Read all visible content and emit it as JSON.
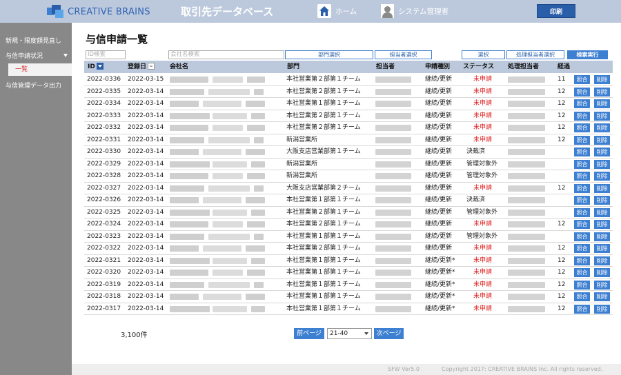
{
  "header": {
    "logo_text": "CREATIVE BRAINS",
    "app_title": "取引先データベース",
    "home_label": "ホーム",
    "user_label": "システム管理者",
    "print_label": "印刷"
  },
  "sidebar": {
    "item1": "新規・限度額見直し",
    "item2": "与信申請状況",
    "sub1": "一覧",
    "item3": "与信管理データ出力"
  },
  "page_title": "与信申請一覧",
  "filters": {
    "id_placeholder": "ID検索",
    "company_placeholder": "会社名検索",
    "dept_btn": "部門選択",
    "owner_btn": "担当者選択",
    "select_btn": "選択",
    "handler_btn": "処理担当者選択",
    "search_btn": "検索実行"
  },
  "columns": {
    "id": "ID",
    "date": "登録日",
    "company": "会社名",
    "dept": "部門",
    "owner": "担当者",
    "type": "申請種別",
    "status": "ステータス",
    "handler": "処理担当者",
    "elapsed": "経過"
  },
  "buttons": {
    "match": "照合",
    "delete": "削除"
  },
  "rows": [
    {
      "id": "2022-0336",
      "date": "2022-03-15",
      "dept": "本社営業第２部第１チーム",
      "type": "継続/更新",
      "status": "未申請",
      "status_red": true,
      "elapsed": "11"
    },
    {
      "id": "2022-0335",
      "date": "2022-03-14",
      "dept": "本社営業第２部第１チーム",
      "type": "継続/更新",
      "status": "未申請",
      "status_red": true,
      "elapsed": "12"
    },
    {
      "id": "2022-0334",
      "date": "2022-03-14",
      "dept": "本社営業第１部第１チーム",
      "type": "継続/更新",
      "status": "未申請",
      "status_red": true,
      "elapsed": "12"
    },
    {
      "id": "2022-0333",
      "date": "2022-03-14",
      "dept": "本社営業第２部第１チーム",
      "type": "継続/更新",
      "status": "未申請",
      "status_red": true,
      "elapsed": "12"
    },
    {
      "id": "2022-0332",
      "date": "2022-03-14",
      "dept": "本社営業第２部第１チーム",
      "type": "継続/更新",
      "status": "未申請",
      "status_red": true,
      "elapsed": "12"
    },
    {
      "id": "2022-0331",
      "date": "2022-03-14",
      "dept": "新潟営業所",
      "type": "継続/更新",
      "status": "未申請",
      "status_red": true,
      "elapsed": "12"
    },
    {
      "id": "2022-0330",
      "date": "2022-03-14",
      "dept": "大阪支店営業部第１チーム",
      "type": "継続/更新",
      "status": "決裁済",
      "status_red": false,
      "elapsed": ""
    },
    {
      "id": "2022-0329",
      "date": "2022-03-14",
      "dept": "新潟営業所",
      "type": "継続/更新",
      "status": "管理対象外",
      "status_red": false,
      "elapsed": ""
    },
    {
      "id": "2022-0328",
      "date": "2022-03-14",
      "dept": "新潟営業所",
      "type": "継続/更新",
      "status": "管理対象外",
      "status_red": false,
      "elapsed": ""
    },
    {
      "id": "2022-0327",
      "date": "2022-03-14",
      "dept": "大阪支店営業部第２チーム",
      "type": "継続/更新",
      "status": "未申請",
      "status_red": true,
      "elapsed": "12"
    },
    {
      "id": "2022-0326",
      "date": "2022-03-14",
      "dept": "本社営業第１部第１チーム",
      "type": "継続/更新",
      "status": "決裁済",
      "status_red": false,
      "elapsed": ""
    },
    {
      "id": "2022-0325",
      "date": "2022-03-14",
      "dept": "本社営業第２部第１チーム",
      "type": "継続/更新",
      "status": "管理対象外",
      "status_red": false,
      "elapsed": ""
    },
    {
      "id": "2022-0324",
      "date": "2022-03-14",
      "dept": "本社営業第２部第１チーム",
      "type": "継続/更新",
      "status": "未申請",
      "status_red": true,
      "elapsed": "12"
    },
    {
      "id": "2022-0323",
      "date": "2022-03-14",
      "dept": "本社営業第１部第１チーム",
      "type": "継続/更新",
      "status": "管理対象外",
      "status_red": false,
      "elapsed": ""
    },
    {
      "id": "2022-0322",
      "date": "2022-03-14",
      "dept": "本社営業第２部第１チーム",
      "type": "継続/更新",
      "status": "未申請",
      "status_red": true,
      "elapsed": "12"
    },
    {
      "id": "2022-0321",
      "date": "2022-03-14",
      "dept": "本社営業第１部第１チーム",
      "type": "継続/更新*",
      "status": "未申請",
      "status_red": true,
      "elapsed": "12"
    },
    {
      "id": "2022-0320",
      "date": "2022-03-14",
      "dept": "本社営業第１部第１チーム",
      "type": "継続/更新*",
      "status": "未申請",
      "status_red": true,
      "elapsed": "12"
    },
    {
      "id": "2022-0319",
      "date": "2022-03-14",
      "dept": "本社営業第１部第１チーム",
      "type": "継続/更新*",
      "status": "未申請",
      "status_red": true,
      "elapsed": "12"
    },
    {
      "id": "2022-0318",
      "date": "2022-03-14",
      "dept": "本社営業第１部第１チーム",
      "type": "継続/更新*",
      "status": "未申請",
      "status_red": true,
      "elapsed": "12"
    },
    {
      "id": "2022-0317",
      "date": "2022-03-14",
      "dept": "本社営業第１部第１チーム",
      "type": "継続/更新*",
      "status": "未申請",
      "status_red": true,
      "elapsed": "12"
    }
  ],
  "pagination": {
    "total": "3,100件",
    "prev": "前ページ",
    "range": "21-40",
    "next": "次ページ"
  },
  "footer": {
    "version": "SFW Ver5.0",
    "copyright": "Copyright 2017: CREATIVE BRAINS Inc. All rights reserved."
  },
  "colors": {
    "header_bg": "#bcc9dc",
    "accent": "#3d7fd1",
    "sidebar_bg": "#888888",
    "status_red": "#e02020"
  }
}
